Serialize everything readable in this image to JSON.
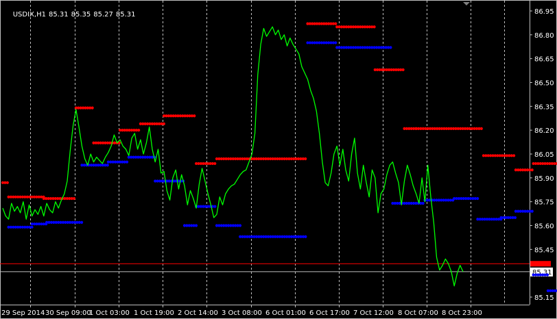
{
  "header": {
    "symbol": "USDIX,H1",
    "open": "85.31",
    "high": "85.35",
    "low": "85.27",
    "close": "85.31"
  },
  "chart_data": {
    "type": "line",
    "title": "",
    "xlabel": "",
    "ylabel": "",
    "grid": true,
    "ylim": [
      85.07,
      87.0
    ],
    "yticks": [
      86.95,
      86.8,
      86.65,
      86.5,
      86.35,
      86.2,
      86.05,
      85.9,
      85.75,
      85.6,
      85.45,
      85.31,
      85.15
    ],
    "xtick_labels": [
      "29 Sep 2014",
      "30 Sep 09:00",
      "1 Oct 03:00",
      "1 Oct 19:00",
      "2 Oct 14:00",
      "3 Oct 08:00",
      "6 Oct 01:00",
      "6 Oct 17:00",
      "7 Oct 12:00",
      "8 Oct 07:00",
      "8 Oct 23:00"
    ],
    "current_price": 85.31,
    "red_line_level": 85.36,
    "colors": {
      "background": "#000000",
      "price_line": "#00ff00",
      "grid": "#c0c0c0",
      "resistance": "#ff0000",
      "support": "#0000ff",
      "price_label_bg": "#ffffff",
      "red_line": "#ff0000"
    },
    "series": [
      {
        "values": [
          85.71,
          85.66,
          85.64,
          85.74,
          85.69,
          85.72,
          85.68,
          85.75,
          85.64,
          85.73,
          85.66,
          85.7,
          85.67,
          85.72,
          85.66,
          85.74,
          85.7,
          85.68,
          85.75,
          85.71,
          85.76,
          85.8,
          85.88,
          86.07,
          86.23,
          86.33,
          86.22,
          86.1,
          86.02,
          85.98,
          86.05,
          86.0,
          86.03,
          86.01,
          85.99,
          86.03,
          86.06,
          86.1,
          86.17,
          86.12,
          86.14,
          86.1,
          86.08,
          86.04,
          86.15,
          86.18,
          86.08,
          86.14,
          86.05,
          86.12,
          86.22,
          86.08,
          86.0,
          86.08,
          85.93,
          85.94,
          85.82,
          85.76,
          85.9,
          85.95,
          85.83,
          85.92,
          85.85,
          85.73,
          85.82,
          85.77,
          85.71,
          85.86,
          85.96,
          85.88,
          85.8,
          85.73,
          85.65,
          85.67,
          85.78,
          85.73,
          85.8,
          85.83,
          85.85,
          85.86,
          85.89,
          85.92,
          85.94,
          85.95,
          86.0,
          86.05,
          86.18,
          86.55,
          86.74,
          86.84,
          86.79,
          86.82,
          86.85,
          86.8,
          86.83,
          86.77,
          86.8,
          86.73,
          86.78,
          86.74,
          86.71,
          86.68,
          86.6,
          86.56,
          86.52,
          86.45,
          86.4,
          86.32,
          86.18,
          86.0,
          85.87,
          85.85,
          85.93,
          86.05,
          86.1,
          85.98,
          86.08,
          85.95,
          85.88,
          86.05,
          86.15,
          85.93,
          85.83,
          85.98,
          85.87,
          85.78,
          85.95,
          85.9,
          85.68,
          85.8,
          85.83,
          85.92,
          85.98,
          86.0,
          85.93,
          85.87,
          85.73,
          85.88,
          85.98,
          85.92,
          85.85,
          85.8,
          85.74,
          85.9,
          85.75,
          85.98,
          85.78,
          85.62,
          85.4,
          85.32,
          85.35,
          85.39,
          85.36,
          85.31,
          85.22,
          85.3,
          85.35,
          85.31
        ]
      }
    ],
    "resistance_segments": [
      {
        "start": 0,
        "end": 2,
        "value": 85.87
      },
      {
        "start": 2,
        "end": 14,
        "value": 85.78
      },
      {
        "start": 14,
        "end": 25,
        "value": 85.77
      },
      {
        "start": 25,
        "end": 31,
        "value": 86.34
      },
      {
        "start": 31,
        "end": 40,
        "value": 86.12
      },
      {
        "start": 40,
        "end": 47,
        "value": 86.2
      },
      {
        "start": 47,
        "end": 55,
        "value": 86.24
      },
      {
        "start": 55,
        "end": 66,
        "value": 86.29
      },
      {
        "start": 66,
        "end": 73,
        "value": 85.99
      },
      {
        "start": 73,
        "end": 104,
        "value": 86.02
      },
      {
        "start": 104,
        "end": 114,
        "value": 86.87
      },
      {
        "start": 114,
        "end": 127,
        "value": 86.85
      },
      {
        "start": 127,
        "end": 137,
        "value": 86.58
      },
      {
        "start": 137,
        "end": 141,
        "value": 86.21
      },
      {
        "start": 141,
        "end": 164,
        "value": 86.21
      },
      {
        "start": 164,
        "end": 175,
        "value": 86.04
      },
      {
        "start": 175,
        "end": 181,
        "value": 85.95
      },
      {
        "start": 181,
        "end": 192,
        "value": 85.99
      }
    ],
    "support_segments": [
      {
        "start": 2,
        "end": 10,
        "value": 85.59
      },
      {
        "start": 10,
        "end": 15,
        "value": 85.61
      },
      {
        "start": 15,
        "end": 27,
        "value": 85.62
      },
      {
        "start": 27,
        "end": 36,
        "value": 85.98
      },
      {
        "start": 36,
        "end": 43,
        "value": 86.0
      },
      {
        "start": 43,
        "end": 52,
        "value": 86.03
      },
      {
        "start": 52,
        "end": 62,
        "value": 85.88
      },
      {
        "start": 62,
        "end": 66,
        "value": 85.6
      },
      {
        "start": 66,
        "end": 73,
        "value": 85.72
      },
      {
        "start": 73,
        "end": 81,
        "value": 85.6
      },
      {
        "start": 81,
        "end": 104,
        "value": 85.53
      },
      {
        "start": 104,
        "end": 114,
        "value": 86.75
      },
      {
        "start": 114,
        "end": 133,
        "value": 86.72
      },
      {
        "start": 133,
        "end": 144,
        "value": 85.74
      },
      {
        "start": 144,
        "end": 154,
        "value": 85.76
      },
      {
        "start": 154,
        "end": 162,
        "value": 85.77
      },
      {
        "start": 162,
        "end": 170,
        "value": 85.64
      },
      {
        "start": 170,
        "end": 175,
        "value": 85.65
      },
      {
        "start": 175,
        "end": 181,
        "value": 85.69
      },
      {
        "start": 181,
        "end": 186,
        "value": 85.29
      },
      {
        "start": 186,
        "end": 192,
        "value": 85.19
      }
    ]
  }
}
